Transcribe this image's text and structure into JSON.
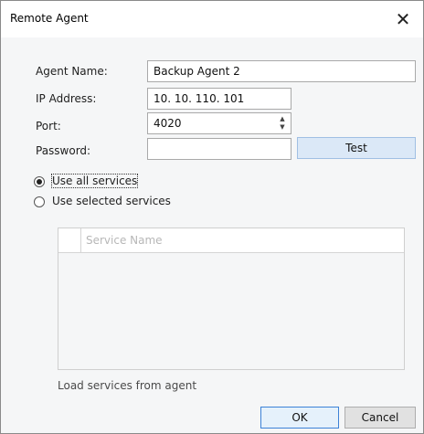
{
  "window": {
    "title": "Remote Agent"
  },
  "form": {
    "agent_name_label": "Agent Name:",
    "agent_name_value": "Backup Agent 2",
    "ip_label": "IP Address:",
    "ip_value": "10. 10. 110. 101",
    "port_label": "Port:",
    "port_value": "4020",
    "password_label": "Password:",
    "password_value": "",
    "test_button": "Test"
  },
  "services": {
    "options": [
      {
        "label": "Use all services",
        "selected": true
      },
      {
        "label": "Use selected services",
        "selected": false
      }
    ],
    "table_header": "Service Name",
    "load_link": "Load services from agent"
  },
  "footer": {
    "ok_label": "OK",
    "cancel_label": "Cancel"
  },
  "colors": {
    "accent": "#3c82d7",
    "test_bg": "#dbe8f7"
  }
}
